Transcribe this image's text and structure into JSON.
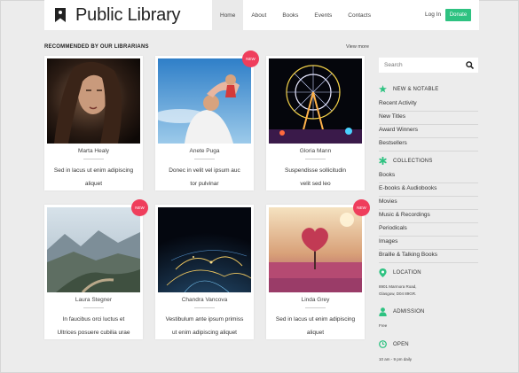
{
  "header": {
    "brand": "Public Library",
    "nav": [
      "Home",
      "About",
      "Books",
      "Events",
      "Contacts"
    ],
    "login": "Log In",
    "donate": "Donate"
  },
  "section": {
    "title": "RECOMMENDED BY OUR LIBRARIANS",
    "view_more": "View more"
  },
  "cards": [
    {
      "author": "Marta Healy",
      "title_line1": "Sed in lacus ut enim adipiscing",
      "title_line2": "aliquet",
      "badge": ""
    },
    {
      "author": "Anete Puga",
      "title_line1": "Donec in velit vel ipsum auc",
      "title_line2": "tor pulvinar",
      "badge": "NEW"
    },
    {
      "author": "Gloria Mann",
      "title_line1": "Suspendisse sollicitudin",
      "title_line2": "velit sed leo",
      "badge": ""
    },
    {
      "author": "Laura Stegner",
      "title_line1": "In faucibus orci luctus et",
      "title_line2": "Ultrices posuere cubilia urae",
      "badge": "NEW"
    },
    {
      "author": "Chandra Vancova",
      "title_line1": "Vestibulum ante ipsum primiss",
      "title_line2": "ut enim adipiscing aliquet",
      "badge": ""
    },
    {
      "author": "Linda Grey",
      "title_line1": "Sed in lacus ut enim adipiscing",
      "title_line2": "aliquet",
      "badge": "NEW"
    }
  ],
  "search": {
    "placeholder": "Search"
  },
  "sidebar": {
    "new_notable": {
      "heading": "NEW & NOTABLE",
      "items": [
        "Recent Activity",
        "New Titles",
        "Award Winners",
        "Bestsellers"
      ]
    },
    "collections": {
      "heading": "COLLECTIONS",
      "items": [
        "Books",
        "E-books & Audiobooks",
        "Movies",
        "Music & Recordings",
        "Periodicals",
        "Images",
        "Braille & Talking Books"
      ]
    },
    "location": {
      "heading": "LOCATION",
      "line1": "8901 Marmora Road,",
      "line2": "Glasgow, D04 89GR."
    },
    "admission": {
      "heading": "ADMISSION",
      "text": "Free"
    },
    "open": {
      "heading": "OPEN",
      "text": "10 am - 9 pm daily"
    }
  },
  "colors": {
    "accent": "#2ec281",
    "badge": "#ef3e5c",
    "background": "#ececec"
  }
}
